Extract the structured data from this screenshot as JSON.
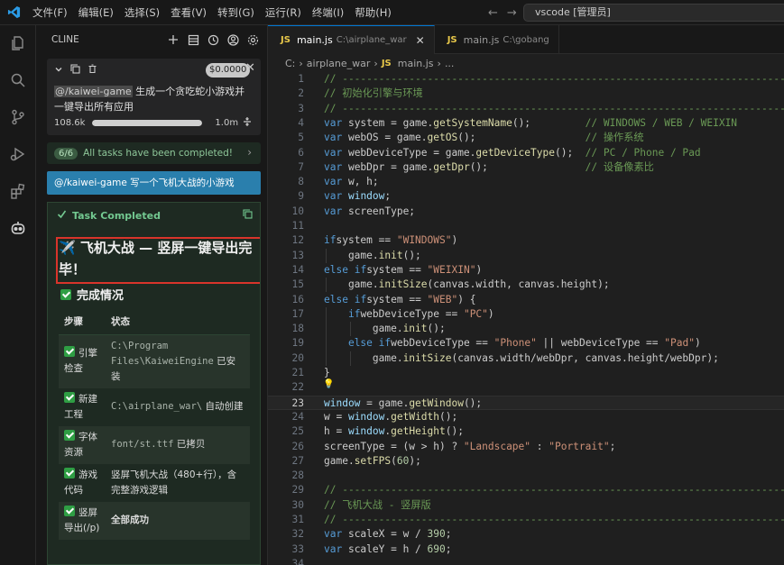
{
  "menu": [
    "文件(F)",
    "编辑(E)",
    "选择(S)",
    "查看(V)",
    "转到(G)",
    "运行(R)",
    "终端(I)",
    "帮助(H)"
  ],
  "command_center": "vscode [管理员]",
  "sidebar": {
    "title": "CLINE",
    "task": {
      "cost": "$0.0000",
      "mention": "@/kaiwei-game",
      "text": " 生成一个贪吃蛇小游戏并一键导出所有应用",
      "context_used": "108.6k",
      "context_max": "1.0m",
      "context_fraction": 1.0
    },
    "tasks_completed": {
      "count": "6/6",
      "label": "All tasks have been completed!"
    },
    "user_message": "@/kaiwei-game 写一个飞机大战的小游戏",
    "completion": {
      "header": "Task Completed",
      "title": "✈️ 飞机大战 — 竖屏一键导出完毕！",
      "section": "完成情况",
      "columns": [
        "步骤",
        "状态"
      ],
      "rows": [
        {
          "step": "引擎检查",
          "mono": "C:\\Program Files\\KaiweiEngine",
          "status": " 已安装"
        },
        {
          "step": "新建工程",
          "mono": "C:\\airplane_war\\",
          "status": " 自动创建"
        },
        {
          "step": "字体资源",
          "mono": "font/st.ttf",
          "status": " 已拷贝"
        },
        {
          "step": "游戏代码",
          "mono": "",
          "status": "竖屏飞机大战（480+行），含完整游戏逻辑"
        },
        {
          "step": "竖屏导出(/p)",
          "mono": "",
          "status": "全部成功"
        }
      ]
    }
  },
  "editor": {
    "tabs": [
      {
        "name": "main.js",
        "desc": "C:\\airplane_war",
        "active": true
      },
      {
        "name": "main.js",
        "desc": "C:\\gobang",
        "active": false
      }
    ],
    "breadcrumbs": [
      "C:",
      "airplane_war",
      "main.js",
      "..."
    ],
    "js_badge": "JS",
    "current_line": 23,
    "lines": [
      {
        "n": "1",
        "t": "// ----------------------------------------------------------------------------"
      },
      {
        "n": "2",
        "t": "// 初始化引擎与环境"
      },
      {
        "n": "3",
        "t": "// ----------------------------------------------------------------------------"
      },
      {
        "n": "4",
        "t": "var system = game.getSystemName();         // WINDOWS / WEB / WEIXIN"
      },
      {
        "n": "5",
        "t": "var webOS = game.getOS();                  // 操作系统"
      },
      {
        "n": "6",
        "t": "var webDeviceType = game.getDeviceType();  // PC / Phone / Pad"
      },
      {
        "n": "7",
        "t": "var webDpr = game.getDpr();                // 设备像素比"
      },
      {
        "n": "8",
        "t": "var w, h;"
      },
      {
        "n": "9",
        "t": "var window;"
      },
      {
        "n": "10",
        "t": "var screenType;"
      },
      {
        "n": "11",
        "t": ""
      },
      {
        "n": "12",
        "t": "if (system == \"WINDOWS\")"
      },
      {
        "n": "13",
        "t": "    game.init();"
      },
      {
        "n": "14",
        "t": "else if (system == \"WEIXIN\")"
      },
      {
        "n": "15",
        "t": "    game.initSize(canvas.width, canvas.height);"
      },
      {
        "n": "16",
        "t": "else if (system == \"WEB\") {"
      },
      {
        "n": "17",
        "t": "    if (webDeviceType == \"PC\")"
      },
      {
        "n": "18",
        "t": "        game.init();"
      },
      {
        "n": "19",
        "t": "    else if (webDeviceType == \"Phone\" || webDeviceType == \"Pad\")"
      },
      {
        "n": "20",
        "t": "        game.initSize(canvas.width/webDpr, canvas.height/webDpr);"
      },
      {
        "n": "21",
        "t": "}"
      },
      {
        "n": "22",
        "t": ""
      },
      {
        "n": "23",
        "t": "window = game.getWindow();"
      },
      {
        "n": "24",
        "t": "w = window.getWidth();"
      },
      {
        "n": "25",
        "t": "h = window.getHeight();"
      },
      {
        "n": "26",
        "t": "screenType = (w > h) ? \"Landscape\" : \"Portrait\";"
      },
      {
        "n": "27",
        "t": "game.setFPS(60);"
      },
      {
        "n": "28",
        "t": ""
      },
      {
        "n": "29",
        "t": "// ----------------------------------------------------------------------------"
      },
      {
        "n": "30",
        "t": "// 飞机大战 - 竖屏版"
      },
      {
        "n": "31",
        "t": "// ----------------------------------------------------------------------------"
      },
      {
        "n": "32",
        "t": "var scaleX = w / 390;"
      },
      {
        "n": "33",
        "t": "var scaleY = h / 690;"
      },
      {
        "n": "34",
        "t": ""
      }
    ]
  },
  "colors": {
    "accent": "#0078d4",
    "user_message": "#2a7fad",
    "success": "#73c991",
    "highlight_box": "#d9342b"
  }
}
